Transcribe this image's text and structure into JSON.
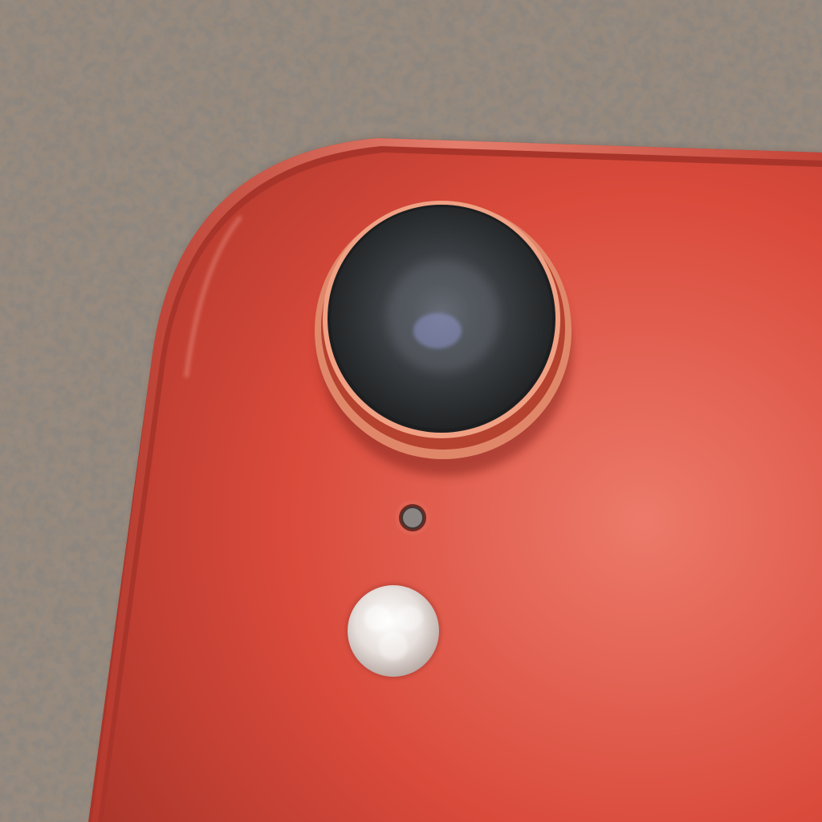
{
  "scene": {
    "subject": "camera-lens",
    "colors": {
      "phone_body": "#d94a3b",
      "phone_body_light": "#ec7a6a",
      "phone_body_dark": "#a9352a",
      "lens_glass": "#2f3234",
      "lens_ring": "#e0876a",
      "countertop": "#8d7f72",
      "countertop_dark": "#4e4740",
      "countertop_light": "#c9bdb0",
      "flash": "#e6dfdb"
    }
  }
}
